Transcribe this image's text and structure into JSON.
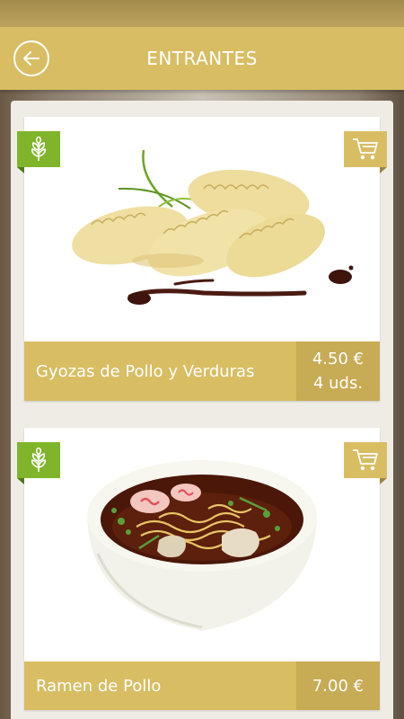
{
  "header": {
    "title": "ENTRANTES"
  },
  "colors": {
    "gold": "#d8bd63",
    "gold_dark": "#c7ab55",
    "green_badge": "#7fb52a",
    "background": "#efece6"
  },
  "icons": {
    "back": "back-arrow-icon",
    "leaf": "wheat-leaf-icon",
    "cart": "shopping-cart-icon"
  },
  "items": [
    {
      "name": "Gyozas de Pollo y Verduras",
      "price": "4.50 €",
      "units": "4 uds."
    },
    {
      "name": "Ramen de Pollo",
      "price": "7.00 €"
    }
  ]
}
